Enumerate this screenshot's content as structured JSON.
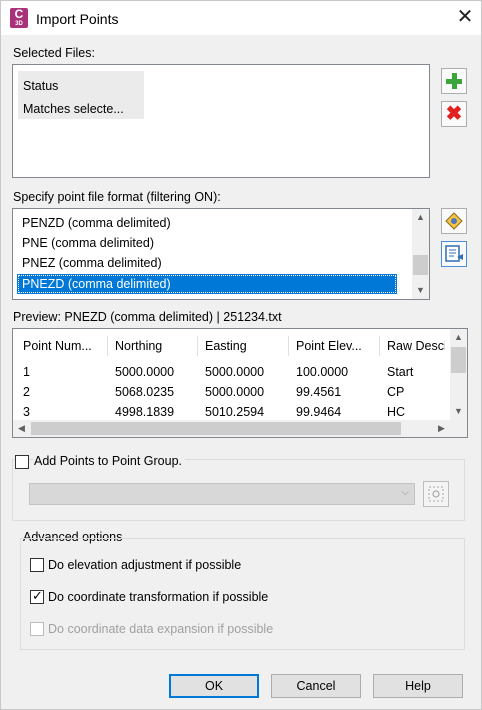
{
  "window": {
    "title": "Import Points",
    "app_icon_letter": "C",
    "app_icon_sub": "3D"
  },
  "selected_files": {
    "label": "Selected Files:",
    "columns": [
      "Status",
      "Matches selecte..."
    ]
  },
  "format": {
    "label": "Specify point file format (filtering ON):",
    "items": [
      {
        "label": "PENZD (comma delimited)",
        "selected": false
      },
      {
        "label": "PNE (comma delimited)",
        "selected": false
      },
      {
        "label": "PNEZ (comma delimited)",
        "selected": false
      },
      {
        "label": "PNEZD (comma delimited)",
        "selected": true
      }
    ]
  },
  "preview": {
    "label": "Preview: PNEZD (comma delimited) | 251234.txt",
    "headers": [
      "Point Num...",
      "Northing",
      "Easting",
      "Point Elev...",
      "Raw Desci"
    ],
    "rows": [
      [
        "1",
        "5000.0000",
        "5000.0000",
        "100.0000",
        "Start"
      ],
      [
        "2",
        "5068.0235",
        "5000.0000",
        "99.4561",
        "CP"
      ],
      [
        "3",
        "4998.1839",
        "5010.2594",
        "99.9464",
        "HC"
      ]
    ]
  },
  "point_group": {
    "label": "Add Points to Point Group.",
    "checked": false,
    "combo_value": ""
  },
  "advanced": {
    "label": "Advanced options",
    "options": [
      {
        "label": "Do elevation adjustment if possible",
        "checked": false,
        "enabled": true
      },
      {
        "label": "Do coordinate transformation if possible",
        "checked": true,
        "enabled": true
      },
      {
        "label": "Do coordinate data expansion if possible",
        "checked": false,
        "enabled": false
      }
    ]
  },
  "buttons": {
    "ok": "OK",
    "cancel": "Cancel",
    "help": "Help"
  },
  "glyphs": {
    "close": "✕",
    "check": "✓",
    "up": "▲",
    "down": "▼",
    "left": "◀",
    "right": "▶",
    "chevron": "⌵",
    "xmark": "✖"
  },
  "colors": {
    "accent": "#0078d7",
    "add_green": "#3aa63a",
    "remove_red": "#e41f1f",
    "app_icon": "#a9337b"
  }
}
